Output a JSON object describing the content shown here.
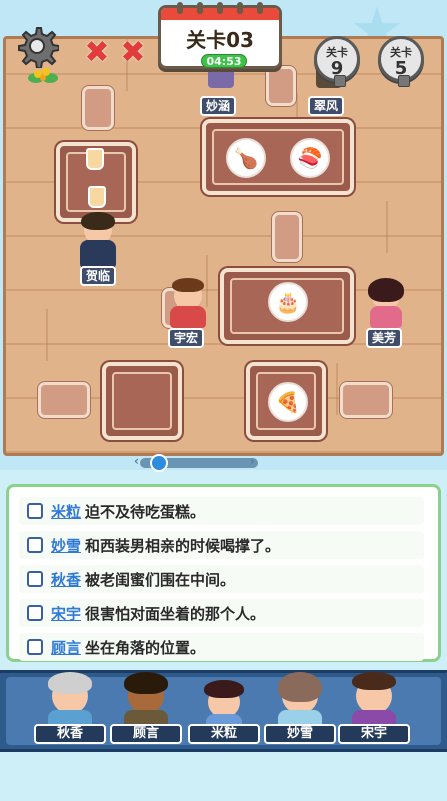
{
  "level": {
    "title": "关卡03",
    "timer": "04:53"
  },
  "mistakes": 2,
  "locked_levels": [
    {
      "label": "关卡",
      "number": "9"
    },
    {
      "label": "关卡",
      "number": "5"
    }
  ],
  "scene_people": [
    {
      "name": "妙涵"
    },
    {
      "name": "翠风"
    },
    {
      "name": "贺临"
    },
    {
      "name": "宇宏"
    },
    {
      "name": "美芳"
    }
  ],
  "clues": [
    {
      "name": "米粒",
      "text": "迫不及待吃蛋糕。"
    },
    {
      "name": "妙雪",
      "text": "和西装男相亲的时候喝撑了。"
    },
    {
      "name": "秋香",
      "text": "被老闺蜜们围在中间。"
    },
    {
      "name": "宋宇",
      "text": "很害怕对面坐着的那个人。"
    },
    {
      "name": "顾言",
      "text": "坐在角落的位置。"
    }
  ],
  "cast": [
    {
      "name": "秋香"
    },
    {
      "name": "顾言"
    },
    {
      "name": "米粒"
    },
    {
      "name": "妙雪"
    },
    {
      "name": "宋宇"
    }
  ],
  "colors": {
    "floor": "#e1b38a",
    "table": "#9a5a4c",
    "clue_name": "#2f7ad6",
    "panel_border": "#8ad18c",
    "cast_bar": "#2f5a8c"
  }
}
